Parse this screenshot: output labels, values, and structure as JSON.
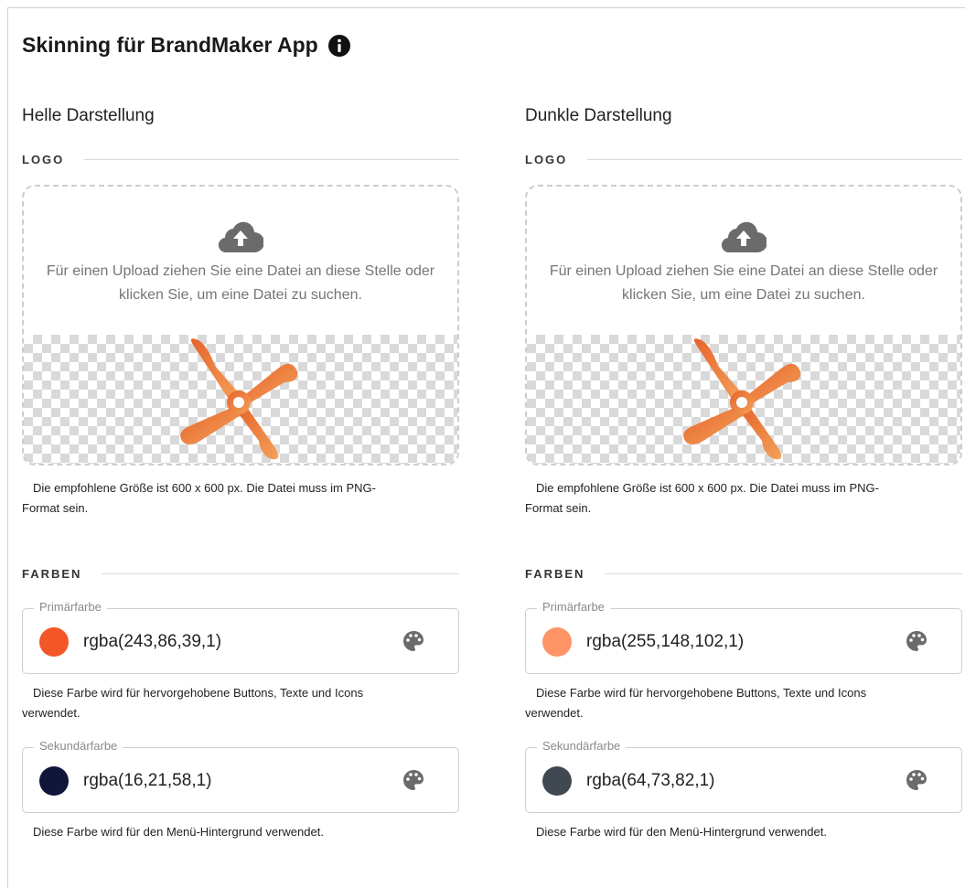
{
  "page": {
    "title": "Skinning für BrandMaker App",
    "info_icon": "info-icon"
  },
  "themes": [
    {
      "title": "Helle Darstellung",
      "logo_section": "LOGO",
      "upload_hint": "Für einen Upload ziehen Sie eine Datei an diese Stelle oder klicken Sie, um eine Datei zu suchen.",
      "logo_help_line1": "Die empfohlene Größe ist 600 x 600 px. Die Datei muss im PNG-",
      "logo_help_line2": "Format sein.",
      "colors_section": "FARBEN",
      "primary": {
        "label": "Primärfarbe",
        "value": "rgba(243,86,39,1)",
        "swatch": "#f35627"
      },
      "primary_help_line1": "Diese Farbe wird für hervorgehobene Buttons, Texte und Icons",
      "primary_help_line2": "verwendet.",
      "secondary": {
        "label": "Sekundärfarbe",
        "value": "rgba(16,21,58,1)",
        "swatch": "#10153a"
      },
      "secondary_help": "Diese Farbe wird für den Menü-Hintergrund verwendet."
    },
    {
      "title": "Dunkle Darstellung",
      "logo_section": "LOGO",
      "upload_hint": "Für einen Upload ziehen Sie eine Datei an diese Stelle oder klicken Sie, um eine Datei zu suchen.",
      "logo_help_line1": "Die empfohlene Größe ist 600 x 600 px. Die Datei muss im PNG-",
      "logo_help_line2": "Format sein.",
      "colors_section": "FARBEN",
      "primary": {
        "label": "Primärfarbe",
        "value": "rgba(255,148,102,1)",
        "swatch": "#ff9466"
      },
      "primary_help_line1": "Diese Farbe wird für hervorgehobene Buttons, Texte und Icons",
      "primary_help_line2": "verwendet.",
      "secondary": {
        "label": "Sekundärfarbe",
        "value": "rgba(64,73,82,1)",
        "swatch": "#404952"
      },
      "secondary_help": "Diese Farbe wird für den Menü-Hintergrund verwendet."
    }
  ],
  "icons": {
    "upload": "cloud-upload-icon",
    "palette": "palette-icon",
    "logo": "brandmaker-logo"
  },
  "colors": {
    "icon_gray": "#6b6b6b",
    "logo_orange_dark": "#e8632b",
    "logo_orange_light": "#f2a25a"
  }
}
